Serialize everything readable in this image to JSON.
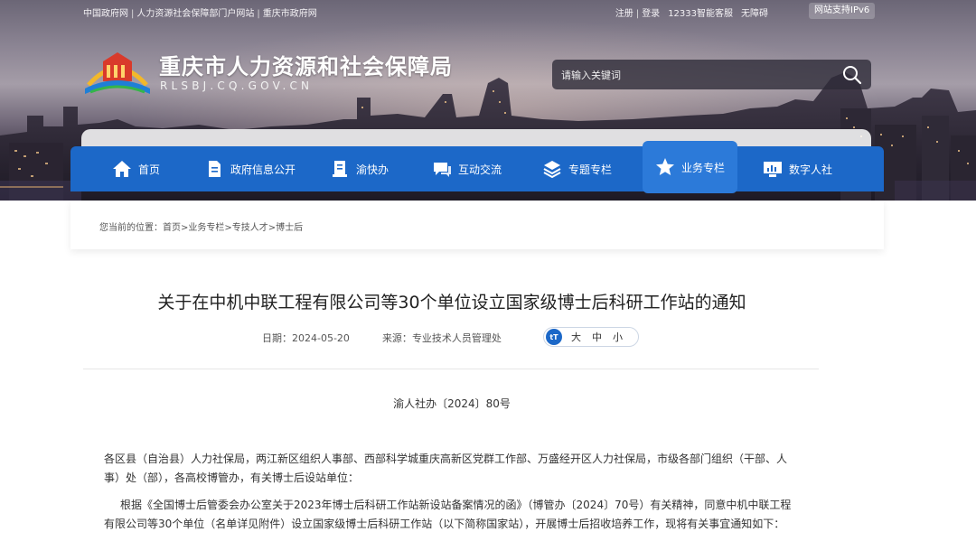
{
  "topbar": {
    "left_links": [
      "中国政府网",
      "人力资源社会保障部门户网站",
      "重庆市政府网"
    ],
    "right_links": [
      "注册",
      "登录"
    ],
    "service": "12333智能客服",
    "accessibility": "无障碍",
    "ipv6": "网站支持IPv6"
  },
  "header": {
    "title": "重庆市人力资源和社会保障局",
    "domain": "RLSBJ.CQ.GOV.CN"
  },
  "search": {
    "placeholder": "请输入关键词"
  },
  "nav": {
    "items": [
      {
        "label": "首页",
        "icon": "home-icon"
      },
      {
        "label": "政府信息公开",
        "icon": "document-icon"
      },
      {
        "label": "渝快办",
        "icon": "book-icon"
      },
      {
        "label": "互动交流",
        "icon": "chat-icon"
      },
      {
        "label": "专题专栏",
        "icon": "layers-icon"
      },
      {
        "label": "业务专栏",
        "icon": "star-icon",
        "active": true
      },
      {
        "label": "数字人社",
        "icon": "monitor-icon"
      }
    ]
  },
  "breadcrumb": {
    "prefix": "您当前的位置：",
    "items": [
      "首页",
      "业务专栏",
      "专技人才",
      "博士后"
    ]
  },
  "article": {
    "title": "关于在中机中联工程有限公司等30个单位设立国家级博士后科研工作站的通知",
    "date_label": "日期：",
    "date": "2024-05-20",
    "source_label": "来源：",
    "source": "专业技术人员管理处",
    "font_sizes": [
      "大",
      "中",
      "小"
    ],
    "doc_number": "渝人社办〔2024〕80号",
    "paragraphs": [
      "各区县（自治县）人力社保局，两江新区组织人事部、西部科学城重庆高新区党群工作部、万盛经开区人力社保局，市级各部门组织（干部、人事）处（部），各高校博管办，有关博士后设站单位：",
      "根据《全国博士后管委会办公室关于2023年博士后科研工作站新设站备案情况的函》（博管办〔2024〕70号）有关精神，同意中机中联工程有限公司等30个单位（名单详见附件）设立国家级博士后科研工作站（以下简称国家站），开展博士后招收培养工作，现将有关事宜通知如下："
    ]
  },
  "colors": {
    "nav_blue": "#1c68c8",
    "nav_active": "#2c7ad9"
  }
}
